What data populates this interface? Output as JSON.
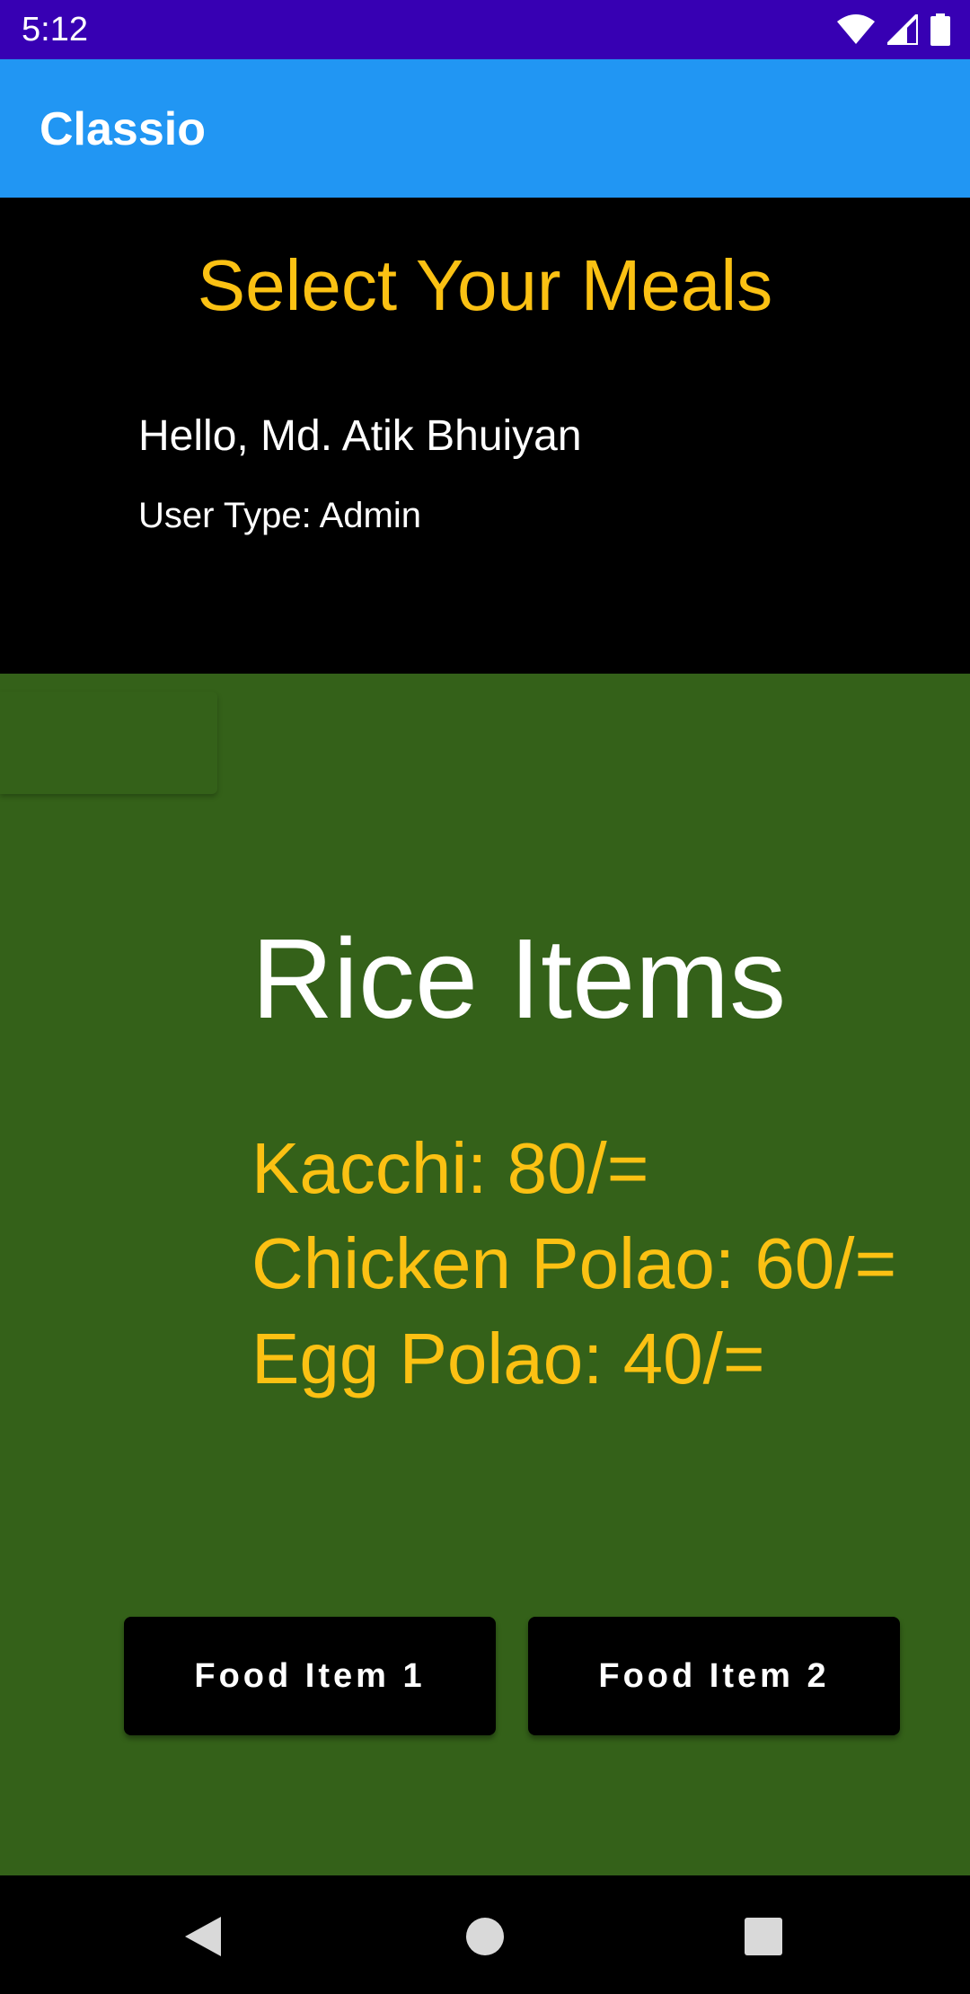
{
  "status_bar": {
    "time": "5:12",
    "icons": [
      "wifi-icon",
      "cell-signal-icon",
      "battery-icon"
    ]
  },
  "app_bar": {
    "title": "Classio"
  },
  "header": {
    "title": "Select Your Meals",
    "greeting": "Hello, Md. Atik Bhuiyan",
    "user_type": "User Type: Admin"
  },
  "menu": {
    "category": "Rice Items",
    "items": [
      "Kacchi: 80/=",
      "Chicken Polao: 60/=",
      "Egg Polao: 40/="
    ]
  },
  "buttons": {
    "food_item_1": "Food Item 1",
    "food_item_2": "Food Item 2"
  },
  "nav_bar": {
    "icons": [
      "back-icon",
      "home-icon",
      "recents-icon"
    ]
  },
  "colors": {
    "status_bar": "#3700B3",
    "app_bar": "#2196F3",
    "accent_yellow": "#FBC113",
    "menu_background": "#346119",
    "header_background": "#000000"
  }
}
